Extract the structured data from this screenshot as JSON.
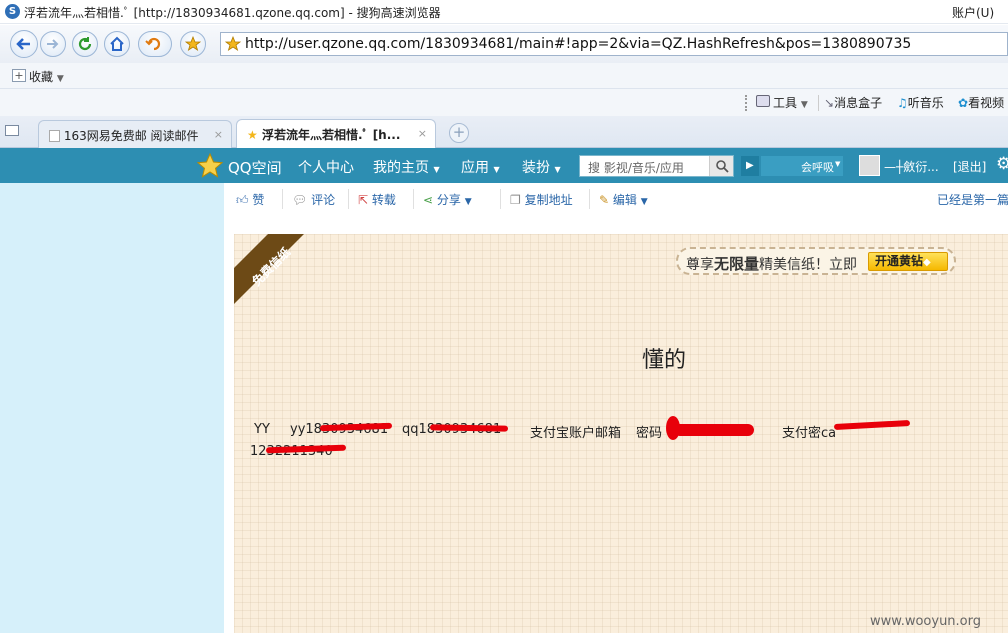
{
  "window": {
    "title": "浮若流年灬若相惜.ﾟ [http://1830934681.qzone.qq.com] - 搜狗高速浏览器",
    "account_label": "账户(U)"
  },
  "browser": {
    "address_url": "http://user.qzone.qq.com/1830934681/main#!app=2&via=QZ.HashRefresh&pos=1380890735",
    "favorites_label": "收藏",
    "tools": {
      "tools_label": "工具",
      "msgbox_label": "消息盒子",
      "music_label": "听音乐",
      "video_label": "看视频"
    },
    "tabs": [
      {
        "label": "163网易免费邮 阅读邮件",
        "active": false
      },
      {
        "label": "浮若流年灬若相惜.ﾟ [h...",
        "active": true
      }
    ]
  },
  "qzone_nav": {
    "logo_label": "QQ空间",
    "items": [
      "个人中心",
      "我的主页",
      "应用",
      "装扮"
    ],
    "search_placeholder": "搜 影视/音乐/应用",
    "call_label": "会呼吸",
    "user_label": "—┼斂衍...",
    "logout_label": "[退出]"
  },
  "actions": {
    "like": "赞",
    "comment": "评论",
    "repost": "转载",
    "share": "分享",
    "copy_address": "复制地址",
    "edit": "编辑",
    "first_post": "已经是第一篇"
  },
  "letter": {
    "ribbon": "免费信纸",
    "promo_prefix": "尊享",
    "promo_emphasis": "无限量",
    "promo_suffix": "精美信纸！立即",
    "promo_button": "开通黄钻",
    "title": "懂的",
    "line1": {
      "yy": "YY",
      "yy_value": "yy1830934681",
      "qq_value": "qq1830934681",
      "alipay": "支付宝账户邮箱",
      "password": "密码",
      "pay_password": "支付密ca"
    },
    "line2": "1232211340"
  },
  "watermark": "www.wooyun.org",
  "colors": {
    "qzone_bar": "#2d8eb2",
    "sidebar": "#d6f0fa",
    "letter_bg": "#faeedc",
    "censor_red": "#e8000a",
    "link_blue": "#2a66a8"
  }
}
